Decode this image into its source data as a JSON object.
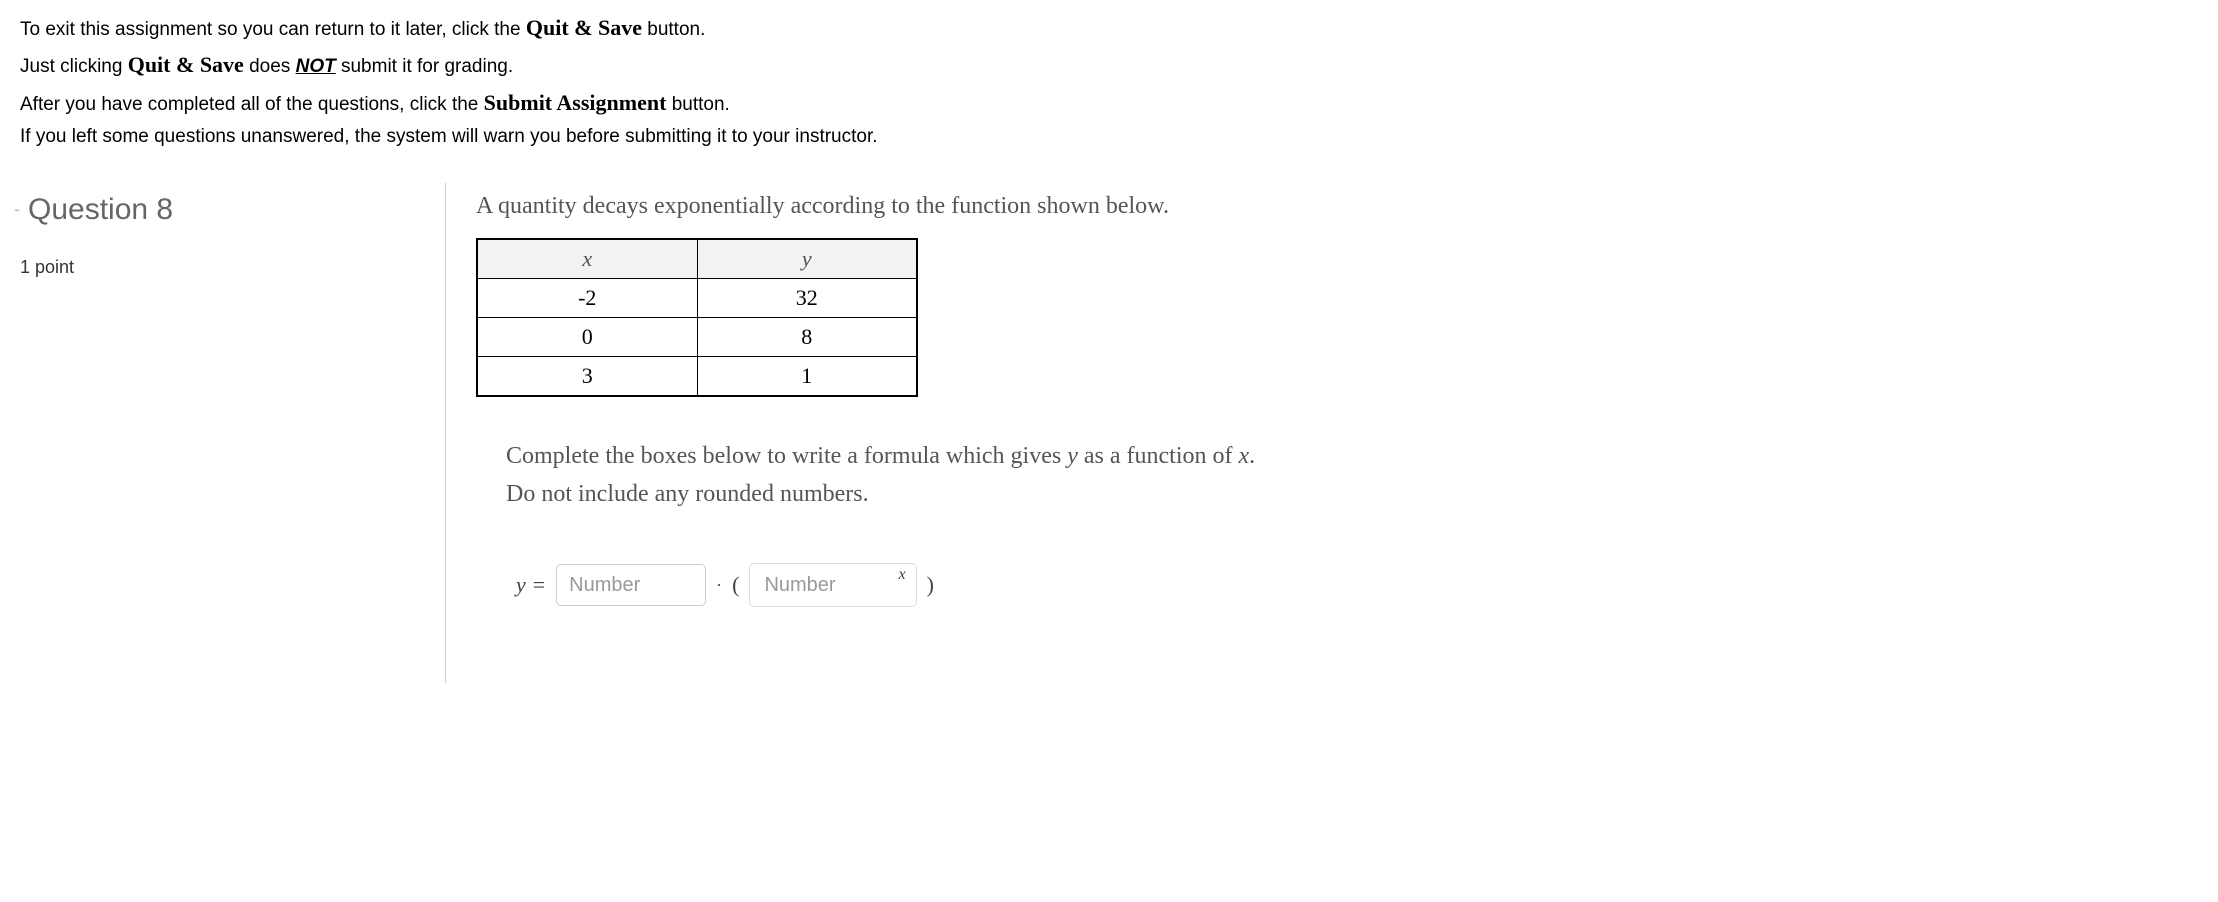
{
  "instructions": {
    "line1_a": "To exit this assignment so you can return to it later, click the ",
    "line1_b": "Quit & Save",
    "line1_c": " button.",
    "line2_a": "Just clicking ",
    "line2_b": "Quit & Save",
    "line2_c": " does ",
    "line2_d": "NOT",
    "line2_e": " submit it for grading.",
    "line3_a": "After you have completed all of the questions, click the ",
    "line3_b": "Submit Assignment",
    "line3_c": " button.",
    "line4": "If you left some questions unanswered, the system will warn you before submitting it to your instructor."
  },
  "sidebar": {
    "collapse": "-",
    "title": "Question 8",
    "points": "1 point"
  },
  "content": {
    "prompt": "A quantity decays exponentially according to the function shown below.",
    "table": {
      "head_x": "x",
      "head_y": "y",
      "rows": [
        {
          "x": "-2",
          "y": "32"
        },
        {
          "x": "0",
          "y": "8"
        },
        {
          "x": "3",
          "y": "1"
        }
      ]
    },
    "instr1_a": "Complete the boxes below to write a formula which gives ",
    "instr1_y": "y",
    "instr1_b": " as a function of ",
    "instr1_x": "x",
    "instr1_c": ".",
    "instr2": "Do not include any rounded numbers.",
    "formula": {
      "yeq": "y =",
      "placeholder1": "Number",
      "dot": "·",
      "lparen": "(",
      "placeholder2": "Number",
      "exponent": "x",
      "rparen": ")"
    }
  }
}
